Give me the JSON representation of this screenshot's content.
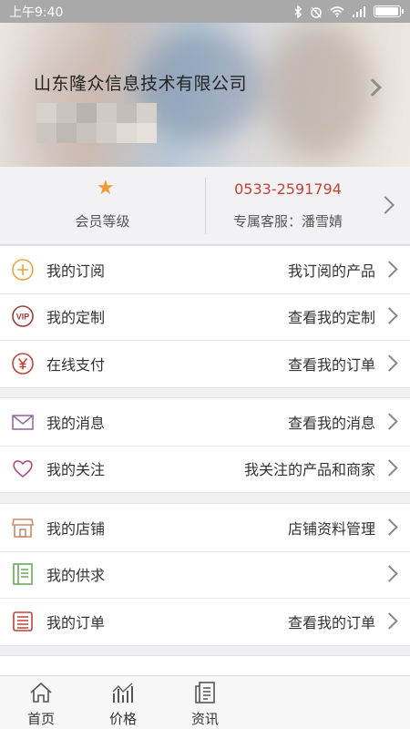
{
  "status_bar": {
    "time": "上午9:40",
    "icons": [
      "bluetooth-icon",
      "alarm-icon",
      "wifi-icon",
      "signal-icon",
      "battery-icon"
    ]
  },
  "header": {
    "company_name": "山东隆众信息技术有限公司"
  },
  "member": {
    "level_label": "会员等级",
    "phone": "0533-2591794",
    "service_label": "专属客服：潘雪婧",
    "accent_color": "#c0443a",
    "star_color": "#f29a38"
  },
  "groups": [
    {
      "items": [
        {
          "icon": "subscribe-plus-icon",
          "title": "我的订阅",
          "hint": "我订阅的产品"
        },
        {
          "icon": "vip-icon",
          "title": "我的定制",
          "hint": "查看我的定制"
        },
        {
          "icon": "yuan-icon",
          "title": "在线支付",
          "hint": "查看我的订单"
        }
      ]
    },
    {
      "items": [
        {
          "icon": "envelope-icon",
          "title": "我的消息",
          "hint": "查看我的消息"
        },
        {
          "icon": "heart-icon",
          "title": "我的关注",
          "hint": "我关注的产品和商家"
        }
      ]
    },
    {
      "items": [
        {
          "icon": "shop-icon",
          "title": "我的店铺",
          "hint": "店铺资料管理"
        },
        {
          "icon": "notebook-icon",
          "title": "我的供求",
          "hint": ""
        },
        {
          "icon": "order-list-icon",
          "title": "我的订单",
          "hint": "查看我的订单"
        }
      ]
    }
  ],
  "tabs": [
    {
      "icon": "home-icon",
      "label": "首页"
    },
    {
      "icon": "price-chart-icon",
      "label": "价格"
    },
    {
      "icon": "news-icon",
      "label": "资讯"
    }
  ]
}
